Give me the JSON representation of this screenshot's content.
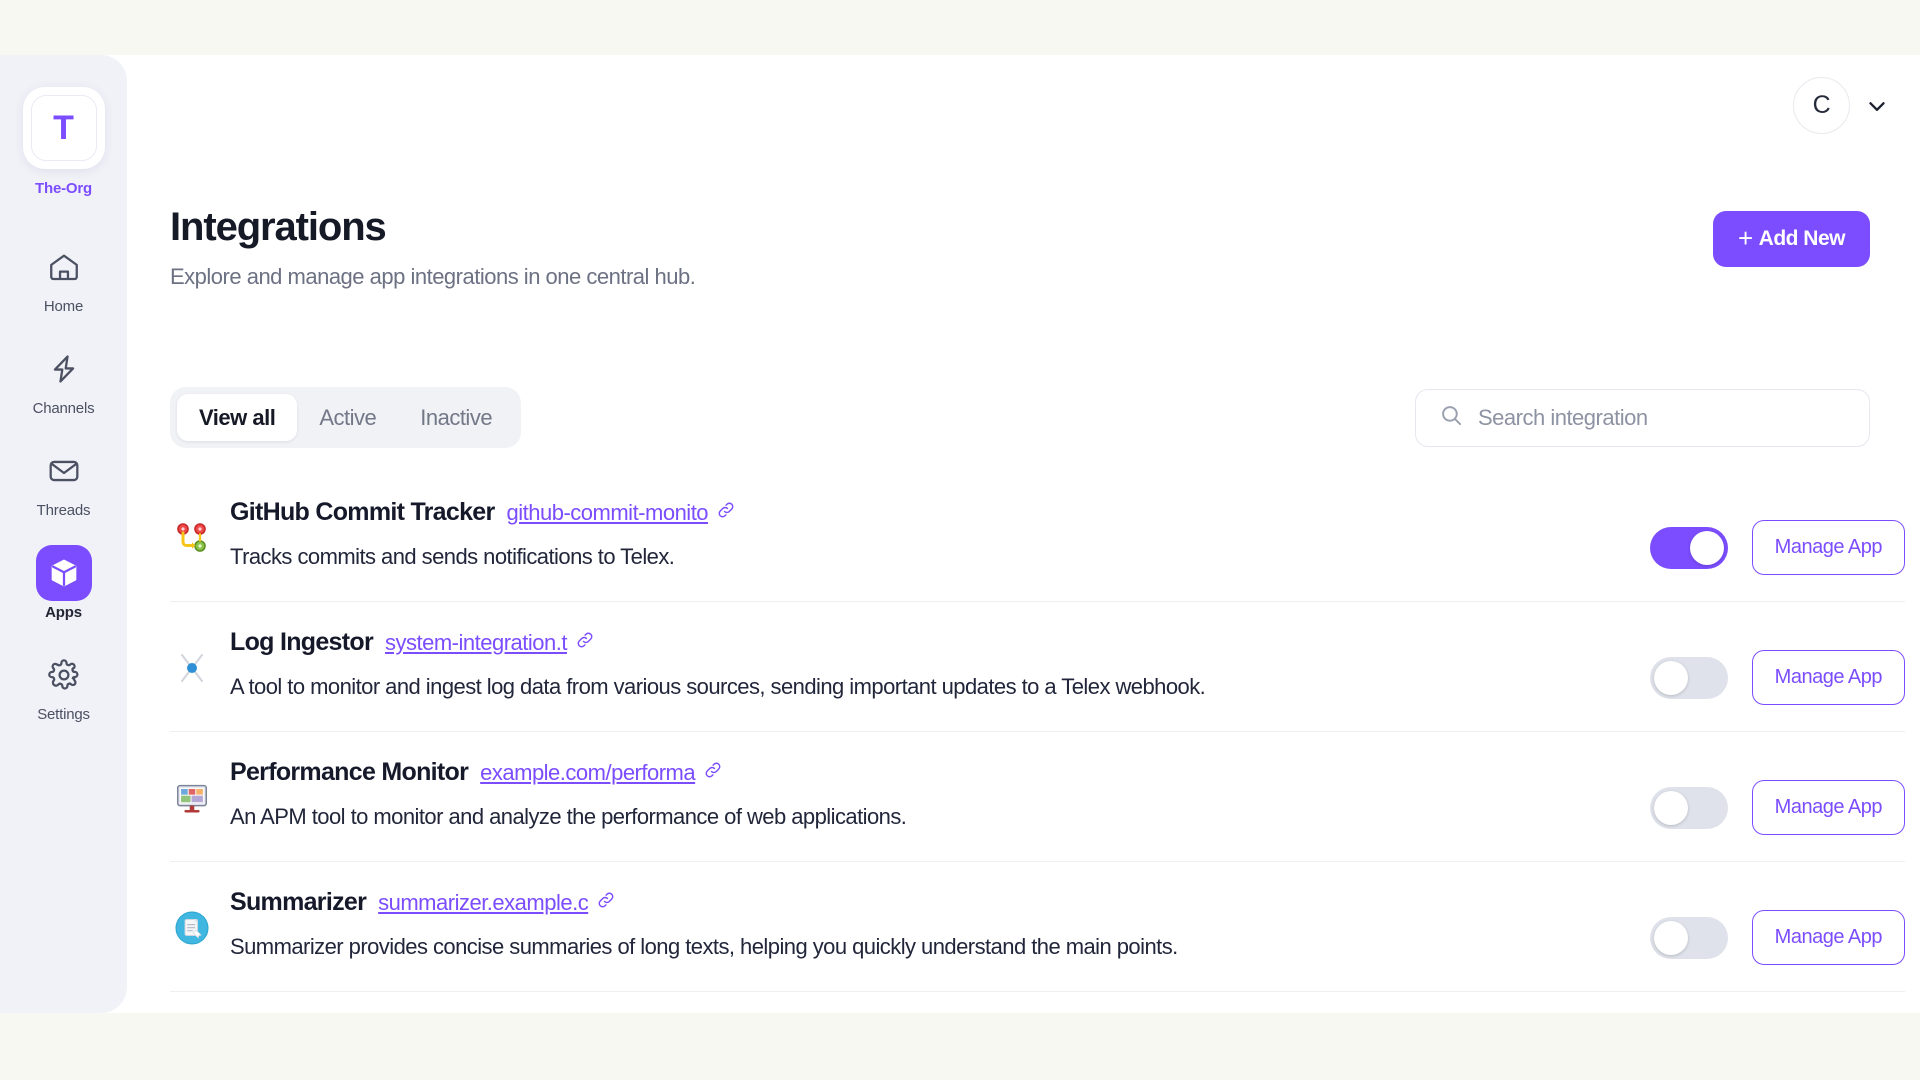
{
  "sidebar": {
    "org": {
      "initial": "T",
      "name": "The-Org"
    },
    "items": [
      {
        "label": "Home",
        "icon": "home-icon",
        "active": false
      },
      {
        "label": "Channels",
        "icon": "lightning-icon",
        "active": false
      },
      {
        "label": "Threads",
        "icon": "envelope-icon",
        "active": false
      },
      {
        "label": "Apps",
        "icon": "box-icon",
        "active": true
      },
      {
        "label": "Settings",
        "icon": "gear-icon",
        "active": false
      }
    ]
  },
  "topbar": {
    "avatar_initial": "C",
    "chevron": "chevron-down-icon"
  },
  "header": {
    "title": "Integrations",
    "subtitle": "Explore and manage app integrations in one central hub.",
    "add_button": {
      "label": "Add New",
      "plus": "+"
    }
  },
  "filters": {
    "tabs": [
      {
        "label": "View all",
        "active": true
      },
      {
        "label": "Active",
        "active": false
      },
      {
        "label": "Inactive",
        "active": false
      }
    ],
    "search": {
      "placeholder": "Search integration",
      "value": ""
    }
  },
  "list": {
    "manage_label": "Manage App",
    "link_glyph": "ὑ7",
    "rows": [
      {
        "icon": "git-branch-icon",
        "title": "GitHub Commit Tracker",
        "link": "github-commit-monito",
        "description": "Tracks commits and sends notifications to Telex.",
        "enabled": true,
        "manage_label": "Manage App"
      },
      {
        "icon": "hourglass-node-icon",
        "title": "Log Ingestor",
        "link": "system-integration.t",
        "description": "A tool to monitor and ingest log data from various sources, sending important updates to a Telex webhook.",
        "enabled": false,
        "manage_label": "Manage App"
      },
      {
        "icon": "desktop-monitor-icon",
        "title": "Performance Monitor",
        "link": "example.com/performa",
        "description": "An APM tool to monitor and analyze the performance of web applications.",
        "enabled": false,
        "manage_label": "Manage App"
      },
      {
        "icon": "summarizer-doc-icon",
        "title": "Summarizer",
        "link": "summarizer.example.c",
        "description": "Summarizer provides concise summaries of long texts, helping you quickly understand the main points.",
        "enabled": false,
        "manage_label": "Manage App"
      }
    ]
  },
  "colors": {
    "accent": "#7b4dff",
    "page_bg": "#f8f8f2",
    "sidebar_bg": "#f1f2f7",
    "toggle_off": "#dfe2ea"
  }
}
